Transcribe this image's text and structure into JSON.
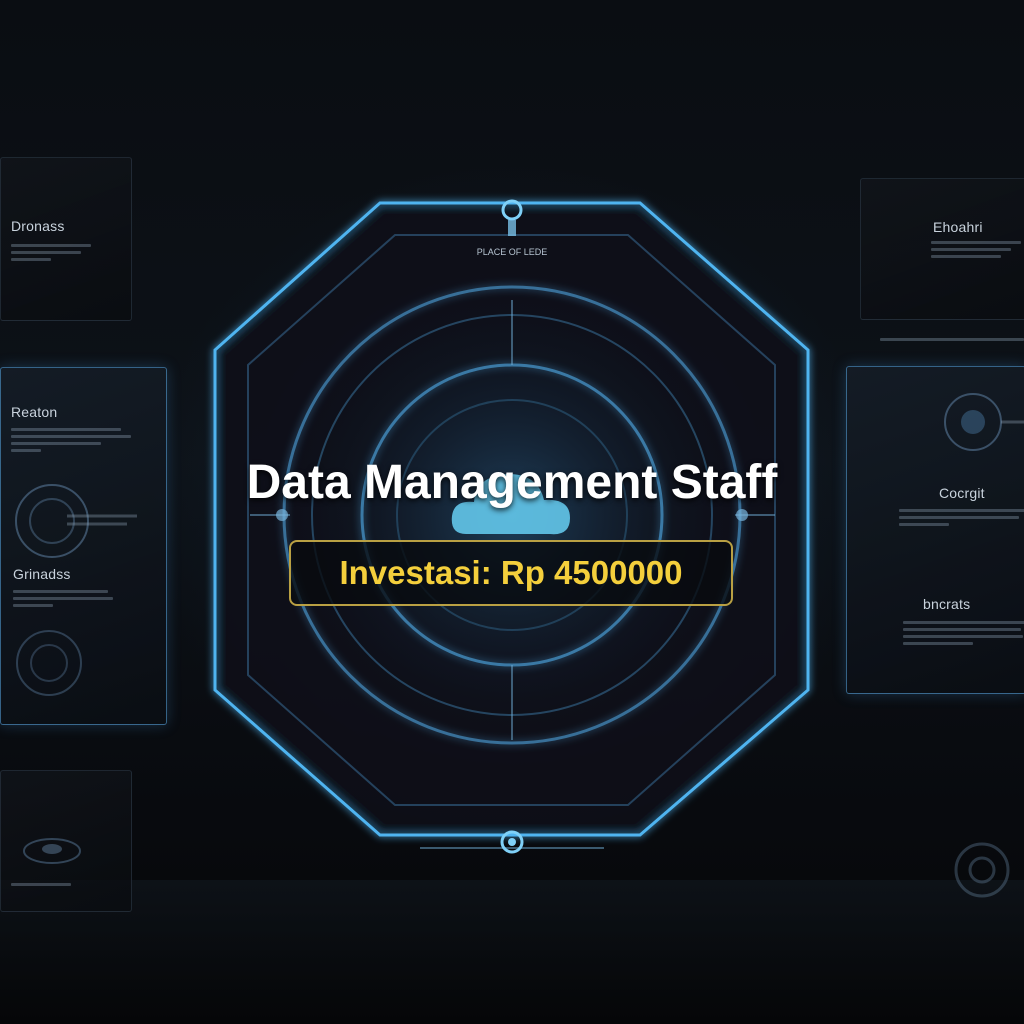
{
  "poster": {
    "title": "Data Management Staff",
    "investment": "Investasi: Rp 4500000"
  },
  "panels": {
    "left_top_heading": "Dronass",
    "left_mid_heading": "Reaton",
    "left_mid_sub": "Grinadss",
    "right_top_heading": "Ehoahri",
    "right_mid_heading": "Cocrgit",
    "right_mid_sub": "bncrats",
    "center_tag": "PLACE OF LEDE"
  },
  "colors": {
    "accent_glow": "#4fb4f0",
    "gold_border": "#b9a043",
    "gold_text": "#f4cf3c",
    "cloud": "#63c7ea"
  },
  "icons": [
    "cloud-icon",
    "connector-node-icon"
  ]
}
